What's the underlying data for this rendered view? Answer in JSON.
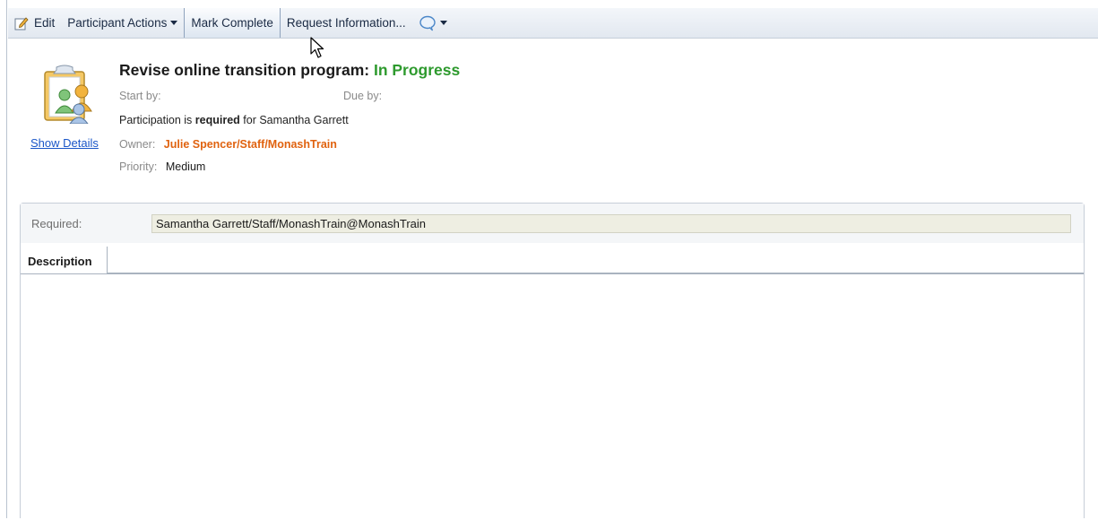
{
  "toolbar": {
    "edit_label": "Edit",
    "participant_actions_label": "Participant Actions",
    "mark_complete_label": "Mark Complete",
    "request_information_label": "Request Information...",
    "icons": [
      "edit-icon",
      "caret-down-icon",
      "chat-bubble-icon"
    ]
  },
  "task": {
    "title": "Revise online transition program:",
    "status": "In Progress",
    "start_by_label": "Start by:",
    "due_by_label": "Due by:",
    "participation_prefix": "Participation is",
    "participation_required": "required",
    "participation_suffix": "for Samantha Garrett",
    "owner_label": "Owner:",
    "owner_value": "Julie Spencer/Staff/MonashTrain",
    "priority_label": "Priority:",
    "priority_value": "Medium",
    "show_details_label": "Show Details"
  },
  "participants": {
    "required_label": "Required:",
    "required_value": "Samantha Garrett/Staff/MonashTrain@MonashTrain"
  },
  "tabs": [
    {
      "label": "Description",
      "selected": true
    }
  ],
  "colors": {
    "status_green": "#2e9a2e",
    "owner_orange": "#e0620f",
    "link_blue": "#1a56c8"
  }
}
